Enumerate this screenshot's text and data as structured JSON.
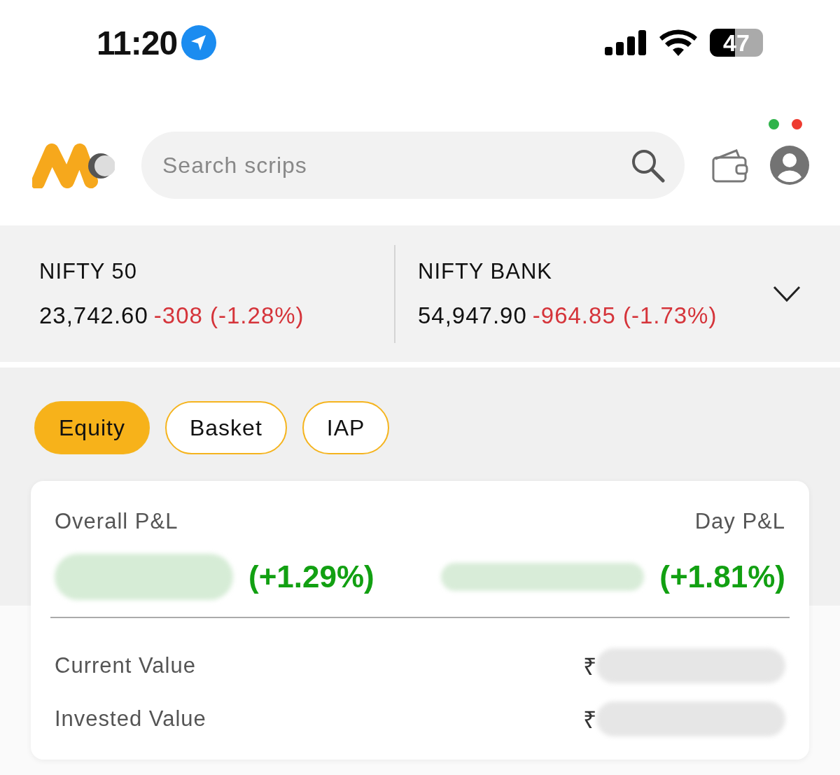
{
  "status_bar": {
    "time": "11:20",
    "battery": "47"
  },
  "header": {
    "search": {
      "placeholder": "Search scrips"
    },
    "status_dots": [
      {
        "color": "#2fb34a"
      },
      {
        "color": "#ee3b30"
      }
    ]
  },
  "indices": [
    {
      "name": "NIFTY 50",
      "value": "23,742.60",
      "change": "-308 (-1.28%)"
    },
    {
      "name": "NIFTY BANK",
      "value": "54,947.90",
      "change": "-964.85 (-1.73%)"
    }
  ],
  "segments": [
    {
      "label": "Equity",
      "selected": true
    },
    {
      "label": "Basket",
      "selected": false
    },
    {
      "label": "IAP",
      "selected": false
    }
  ],
  "summary": {
    "overall_label": "Overall P&L",
    "overall_change": "(+1.29%)",
    "day_label": "Day P&L",
    "day_change": "(+1.81%)",
    "rows": [
      {
        "label": "Current Value",
        "value": "₹"
      },
      {
        "label": "Invested Value",
        "value": "₹"
      }
    ]
  }
}
